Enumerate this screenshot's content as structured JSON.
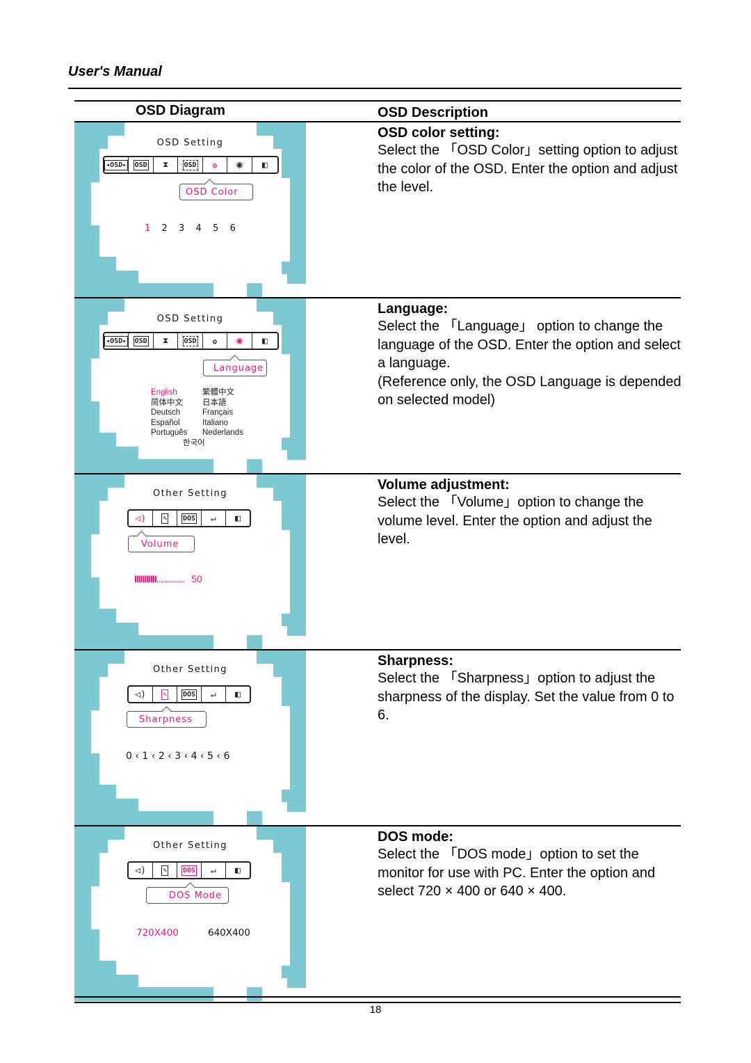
{
  "header": {
    "running_title": "User's Manual"
  },
  "table": {
    "col_diagram": "OSD Diagram",
    "col_description": "OSD Description"
  },
  "colors": {
    "panel_bg": "#7cc9d4",
    "highlight": "#e8157c"
  },
  "rows": [
    {
      "osd": {
        "menu_title": "OSD Setting",
        "toolbar": [
          {
            "icon": "osd-horizontal-position-icon",
            "label": "OSD"
          },
          {
            "icon": "osd-vertical-position-icon",
            "label": "OSD"
          },
          {
            "icon": "hourglass-timeout-icon",
            "label": "⌛"
          },
          {
            "icon": "osd-transparency-icon",
            "label": "OSD"
          },
          {
            "icon": "palette-icon",
            "label": "🎨",
            "active": true
          },
          {
            "icon": "globe-language-icon",
            "label": "🌐"
          },
          {
            "icon": "exit-icon",
            "label": "⇥"
          }
        ],
        "tooltip": "OSD Color",
        "options": [
          "1",
          "2",
          "3",
          "4",
          "5",
          "6"
        ],
        "selected": "1"
      },
      "description": {
        "heading": "OSD color setting:",
        "text": "Select the 「OSD Color」setting option to adjust the color of the OSD. Enter the option and adjust the level."
      }
    },
    {
      "osd": {
        "menu_title": "OSD Setting",
        "tooltip": "Language",
        "languages": [
          "English",
          "繁體中文",
          "简体中文",
          "日本語",
          "Deutsch",
          "Français",
          "Español",
          "Italiano",
          "Português",
          "Nederlands",
          "한국어"
        ],
        "selected": "English"
      },
      "description": {
        "heading": "Language:",
        "text": "Select the 「Language」 option to change the language of the OSD. Enter the option and select a language.",
        "note": "(Reference only, the OSD Language is depended on selected model)"
      }
    },
    {
      "osd": {
        "menu_title": "Other Setting",
        "toolbar": [
          {
            "icon": "speaker-volume-icon",
            "label": "🔊"
          },
          {
            "icon": "sharpness-icon",
            "label": "✎"
          },
          {
            "icon": "dos-mode-icon",
            "label": "DOS"
          },
          {
            "icon": "return-icon",
            "label": "↩"
          },
          {
            "icon": "exit-icon",
            "label": "⇥"
          }
        ],
        "tooltip": "Volume",
        "level_value": "50",
        "level_percent": 50
      },
      "description": {
        "heading": "Volume adjustment:",
        "text": "Select the 「Volume」option to change the volume level. Enter the option and adjust the level."
      }
    },
    {
      "osd": {
        "menu_title": "Other Setting",
        "tooltip": "Sharpness",
        "scale": "0 ‹ 1 ‹ 2 ‹ 3 ‹ 4 ‹ 5 ‹ 6"
      },
      "description": {
        "heading": "Sharpness:",
        "text": "Select the 「Sharpness」option to adjust the sharpness of the display. Set the value from 0 to 6."
      }
    },
    {
      "osd": {
        "menu_title": "Other Setting",
        "tooltip": "DOS Mode",
        "options": [
          "720X400",
          "640X400"
        ],
        "selected": "720X400"
      },
      "description": {
        "heading": "DOS mode:",
        "text": "Select the 「DOS mode」option to set the monitor for use with PC. Enter the option and select 720 × 400 or 640 × 400."
      }
    }
  ],
  "footer": {
    "page_number": "18"
  }
}
